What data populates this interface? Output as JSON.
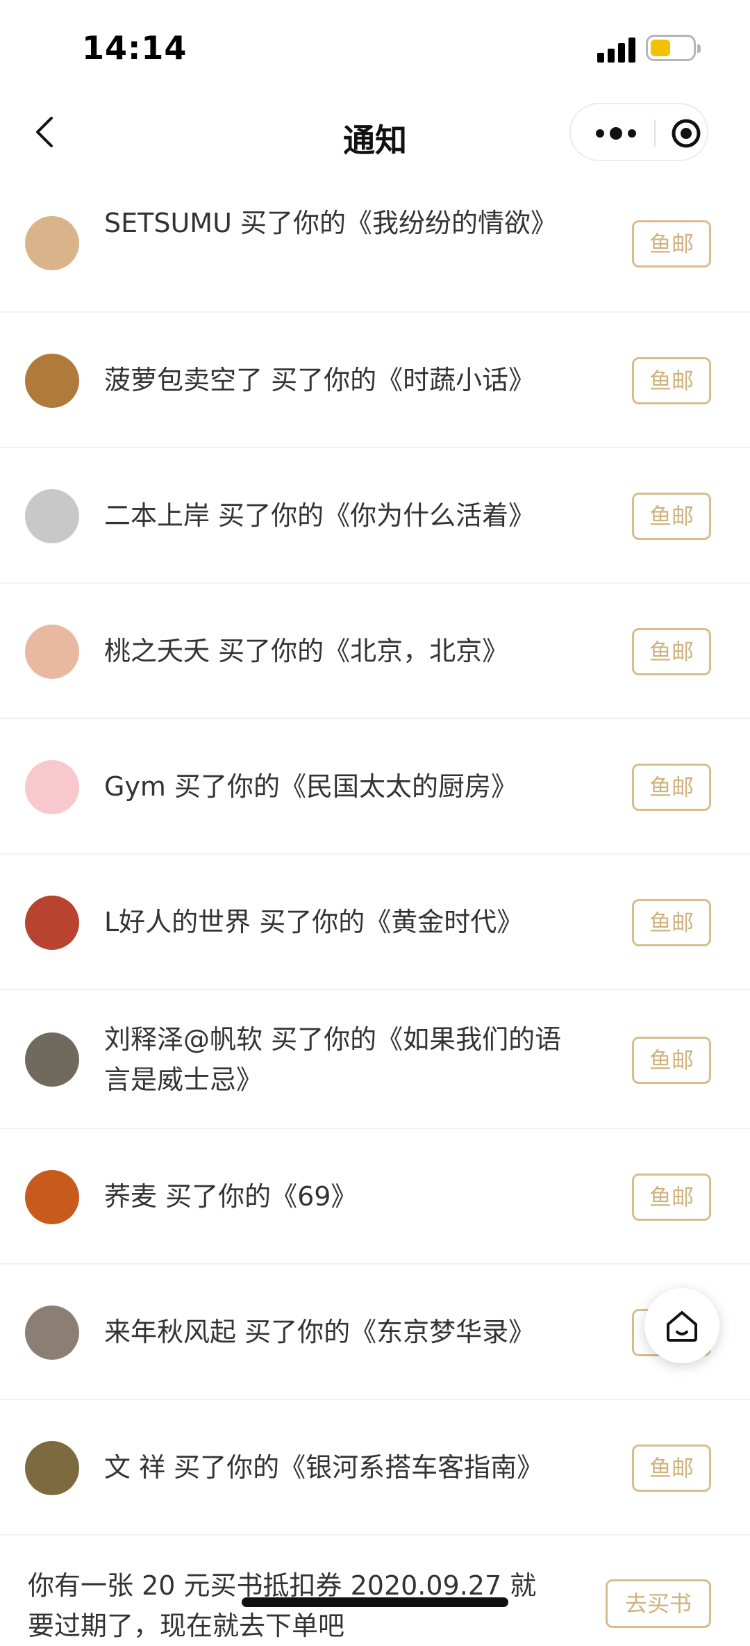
{
  "status_bar": {
    "time": "14:14"
  },
  "nav": {
    "title": "通知",
    "back_icon": "chevron-left-icon",
    "more_icon": "more-dots-icon",
    "close_icon": "target-icon"
  },
  "notifications": [
    {
      "text": "SETSUMU 买了你的《我纷纷的情欲》",
      "button": "鱼邮",
      "avatar_color": "#d9b48b"
    },
    {
      "text": "菠萝包卖空了 买了你的《时蔬小话》",
      "button": "鱼邮",
      "avatar_color": "#b07a3a"
    },
    {
      "text": "二本上岸 买了你的《你为什么活着》",
      "button": "鱼邮",
      "avatar_color": "#c8c8c8"
    },
    {
      "text": "桃之夭夭 买了你的《北京，北京》",
      "button": "鱼邮",
      "avatar_color": "#e8b8a0"
    },
    {
      "text": "Gym 买了你的《民国太太的厨房》",
      "button": "鱼邮",
      "avatar_color": "#f7c9cf"
    },
    {
      "text": "L好人的世界 买了你的《黄金时代》",
      "button": "鱼邮",
      "avatar_color": "#b8432e"
    },
    {
      "text": "刘释泽@帆软 买了你的《如果我们的语言是威士忌》",
      "button": "鱼邮",
      "avatar_color": "#6f6a5c"
    },
    {
      "text": "荞麦 买了你的《69》",
      "button": "鱼邮",
      "avatar_color": "#c85a1e"
    },
    {
      "text": "来年秋风起 买了你的《东京梦华录》",
      "button": "鱼邮",
      "avatar_color": "#8a7f72"
    },
    {
      "text": "文 祥 买了你的《银河系搭车客指南》",
      "button": "鱼邮",
      "avatar_color": "#7d6a3f"
    }
  ],
  "coupon": {
    "text": "你有一张 20 元买书抵扣券 2020.09.27 就要过期了，现在就去下单吧",
    "button": "去买书"
  },
  "home_button": {
    "icon": "home-icon"
  },
  "colors": {
    "accent": "#cfb27d",
    "border": "#d7bd8e"
  }
}
